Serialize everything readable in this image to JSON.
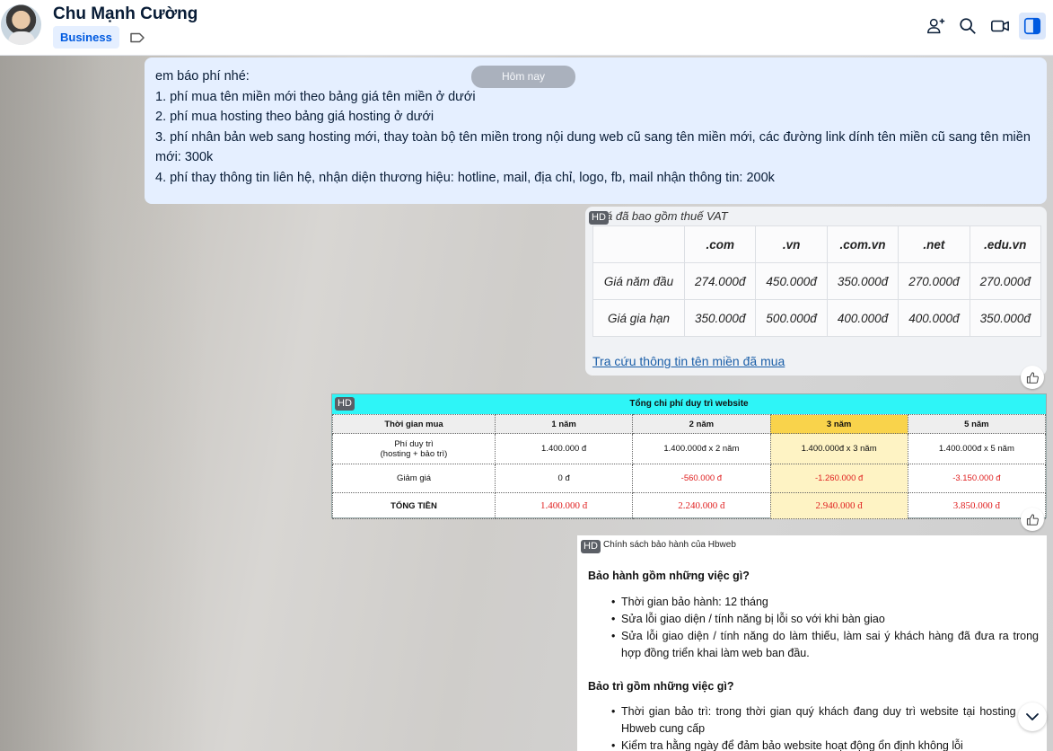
{
  "header": {
    "name": "Chu Mạnh Cường",
    "badge": "Business"
  },
  "chat": {
    "date_pill": "Hôm nay",
    "message_lines": [
      "em báo phí nhé:",
      "1. phí mua tên miền mới theo bảng giá tên miền ở dưới",
      "2. phí mua hosting theo bảng giá hosting ở dưới",
      "3. phí nhân bản web sang hosting mới, thay toàn bộ tên miền trong nội dung web cũ sang tên miền mới, các đường link dính tên miền cũ sang tên miền mới: 300k",
      "4. phí thay thông tin liên hệ, nhận diện thương hiệu: hotline, mail, địa chỉ, logo, fb, mail nhận thông tin: 200k"
    ]
  },
  "domain_card": {
    "hd": "HD",
    "caption": "Giá đã bao gồm thuế VAT",
    "columns": [
      ".com",
      ".vn",
      ".com.vn",
      ".net",
      ".edu.vn"
    ],
    "rows": [
      {
        "label": "Giá năm đầu",
        "values": [
          "274.000đ",
          "450.000đ",
          "350.000đ",
          "270.000đ",
          "270.000đ"
        ]
      },
      {
        "label": "Giá gia hạn",
        "values": [
          "350.000đ",
          "500.000đ",
          "400.000đ",
          "400.000đ",
          "350.000đ"
        ]
      }
    ],
    "link": "Tra cứu thông tin tên miền đã mua"
  },
  "maintenance_card": {
    "hd": "HD",
    "title": "Tổng chi phí duy trì website",
    "header": [
      "Thời gian mua",
      "1 năm",
      "2 năm",
      "3 năm",
      "5 năm"
    ],
    "row_fee_label_1": "Phí duy trì",
    "row_fee_label_2": "(hosting + bảo trì)",
    "row_fee": [
      "1.400.000 đ",
      "1.400.000đ x 2 năm",
      "1.400.000đ x 3 năm",
      "1.400.000đ x 5 năm"
    ],
    "row_discount_label": "Giảm giá",
    "row_discount": [
      "0 đ",
      "-560.000 đ",
      "-1.260.000 đ",
      "-3.150.000 đ"
    ],
    "row_total_label": "TỔNG TIỀN",
    "row_total": [
      "1.400.000 đ",
      "2.240.000 đ",
      "2.940.000 đ",
      "3.850.000 đ"
    ]
  },
  "warranty_card": {
    "hd": "HD",
    "small_title": "Chính sách bảo hành của Hbweb",
    "heading_1": "Bảo hành gồm những việc gì?",
    "items_1": [
      "Thời gian bảo hành: 12 tháng",
      "Sửa lỗi giao diện / tính năng bị lỗi so với khi bàn giao",
      "Sửa lỗi giao diện / tính năng do làm thiếu, làm sai ý khách hàng đã đưa ra trong hợp đồng triển khai làm web ban đầu."
    ],
    "heading_2": "Bảo trì gồm những việc gì?",
    "items_2": [
      "Thời gian bảo trì: trong thời gian quý khách đang duy trì website tại hosting của Hbweb cung cấp",
      "Kiểm tra hằng ngày để đảm bảo website hoạt động ổn định không lỗi"
    ]
  },
  "colors": {
    "accent": "#005ae0",
    "bubble": "#e5efff",
    "title_cyan": "#2ef5f7",
    "highlight": "#f9d34b",
    "negative": "#e02020"
  },
  "icons": [
    "add-member-icon",
    "search-icon",
    "video-call-icon",
    "sidebar-toggle-icon",
    "tag-icon",
    "thumbs-up-icon",
    "chevron-down-icon"
  ]
}
